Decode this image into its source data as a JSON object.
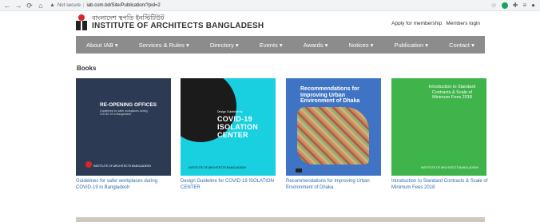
{
  "browser": {
    "back_icon": "←",
    "forward_icon": "→",
    "reload_icon": "⟳",
    "home_icon": "⌂",
    "security": "Not secure",
    "url": "iab.com.bd/Site/Publication/?pid=2",
    "star_icon": "☆",
    "puzzle_icon": "✚",
    "playlist_icon": "≡"
  },
  "header": {
    "org_name_bn": "বাংলাদেশ স্থপতি ইনস্টিটিউট",
    "org_name_en": "INSTITUTE OF ARCHITECTS BANGLADESH",
    "apply_link": "Apply for membership",
    "login_link": "Members login"
  },
  "nav": {
    "items": [
      "About IAB ▾",
      "Services & Rules ▾",
      "Directory ▾",
      "Events ▾",
      "Awards ▾",
      "Notices ▾",
      "Publication ▾",
      "Contact ▾"
    ]
  },
  "section": {
    "title": "Books"
  },
  "books": [
    {
      "caption": "Guidelines for safer workplaces during COVID-19 in Bangladesh",
      "cover_title": "RE-OPENING OFFICES",
      "cover_subtitle": "Guidelines for safer workplaces during COVID-19 in Bangladesh",
      "cover_footer": "INSTITUTE OF ARCHITECTS BANGLADESH"
    },
    {
      "caption": "Design Guideline for COVID-19 ISOLATION CENTER",
      "cover_small": "Design Guideline for",
      "cover_big": "COVID-19 ISOLATION CENTER",
      "cover_footer": "INSTITUTE OF ARCHITECTS BANGLADESH"
    },
    {
      "caption": "Recommendations for Improving Urban Environment of Dhaka",
      "cover_title": "Recommendations for Improving Urban Environment of Dhaka"
    },
    {
      "caption": "Introduction to Standard Contracts & Scale of Minimum Fees 2018",
      "cover_title": "Introduction to Standard Contracts & Scale of Minimum Fees 2018",
      "cover_footer": "INSTITUTE OF ARCHITECTS BANGLADESH"
    }
  ],
  "colors": {
    "nav_bg": "#8c8c8c",
    "link": "#2a6fb0",
    "brand_red": "#d8262b"
  }
}
